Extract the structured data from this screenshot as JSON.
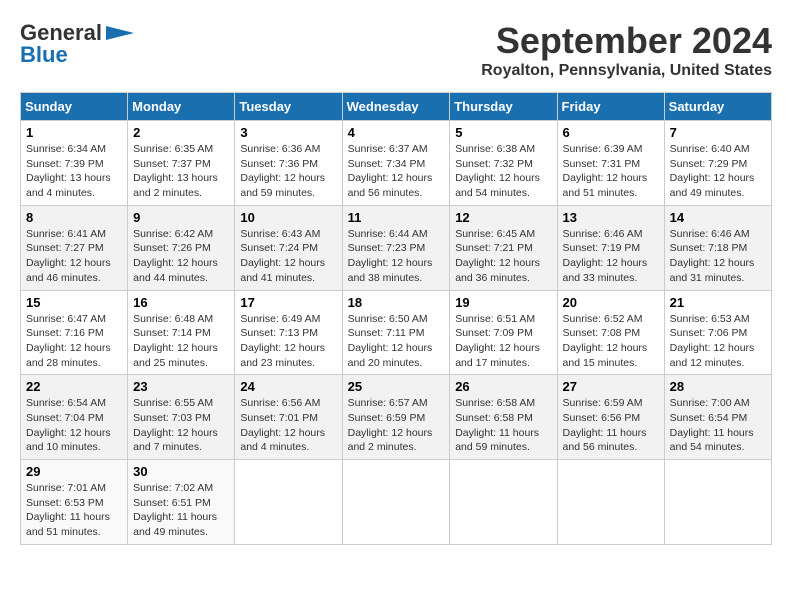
{
  "header": {
    "logo_general": "General",
    "logo_blue": "Blue",
    "month_title": "September 2024",
    "location": "Royalton, Pennsylvania, United States"
  },
  "days_of_week": [
    "Sunday",
    "Monday",
    "Tuesday",
    "Wednesday",
    "Thursday",
    "Friday",
    "Saturday"
  ],
  "weeks": [
    [
      {
        "day": "1",
        "sunrise": "6:34 AM",
        "sunset": "7:39 PM",
        "daylight": "13 hours and 4 minutes."
      },
      {
        "day": "2",
        "sunrise": "6:35 AM",
        "sunset": "7:37 PM",
        "daylight": "13 hours and 2 minutes."
      },
      {
        "day": "3",
        "sunrise": "6:36 AM",
        "sunset": "7:36 PM",
        "daylight": "12 hours and 59 minutes."
      },
      {
        "day": "4",
        "sunrise": "6:37 AM",
        "sunset": "7:34 PM",
        "daylight": "12 hours and 56 minutes."
      },
      {
        "day": "5",
        "sunrise": "6:38 AM",
        "sunset": "7:32 PM",
        "daylight": "12 hours and 54 minutes."
      },
      {
        "day": "6",
        "sunrise": "6:39 AM",
        "sunset": "7:31 PM",
        "daylight": "12 hours and 51 minutes."
      },
      {
        "day": "7",
        "sunrise": "6:40 AM",
        "sunset": "7:29 PM",
        "daylight": "12 hours and 49 minutes."
      }
    ],
    [
      {
        "day": "8",
        "sunrise": "6:41 AM",
        "sunset": "7:27 PM",
        "daylight": "12 hours and 46 minutes."
      },
      {
        "day": "9",
        "sunrise": "6:42 AM",
        "sunset": "7:26 PM",
        "daylight": "12 hours and 44 minutes."
      },
      {
        "day": "10",
        "sunrise": "6:43 AM",
        "sunset": "7:24 PM",
        "daylight": "12 hours and 41 minutes."
      },
      {
        "day": "11",
        "sunrise": "6:44 AM",
        "sunset": "7:23 PM",
        "daylight": "12 hours and 38 minutes."
      },
      {
        "day": "12",
        "sunrise": "6:45 AM",
        "sunset": "7:21 PM",
        "daylight": "12 hours and 36 minutes."
      },
      {
        "day": "13",
        "sunrise": "6:46 AM",
        "sunset": "7:19 PM",
        "daylight": "12 hours and 33 minutes."
      },
      {
        "day": "14",
        "sunrise": "6:46 AM",
        "sunset": "7:18 PM",
        "daylight": "12 hours and 31 minutes."
      }
    ],
    [
      {
        "day": "15",
        "sunrise": "6:47 AM",
        "sunset": "7:16 PM",
        "daylight": "12 hours and 28 minutes."
      },
      {
        "day": "16",
        "sunrise": "6:48 AM",
        "sunset": "7:14 PM",
        "daylight": "12 hours and 25 minutes."
      },
      {
        "day": "17",
        "sunrise": "6:49 AM",
        "sunset": "7:13 PM",
        "daylight": "12 hours and 23 minutes."
      },
      {
        "day": "18",
        "sunrise": "6:50 AM",
        "sunset": "7:11 PM",
        "daylight": "12 hours and 20 minutes."
      },
      {
        "day": "19",
        "sunrise": "6:51 AM",
        "sunset": "7:09 PM",
        "daylight": "12 hours and 17 minutes."
      },
      {
        "day": "20",
        "sunrise": "6:52 AM",
        "sunset": "7:08 PM",
        "daylight": "12 hours and 15 minutes."
      },
      {
        "day": "21",
        "sunrise": "6:53 AM",
        "sunset": "7:06 PM",
        "daylight": "12 hours and 12 minutes."
      }
    ],
    [
      {
        "day": "22",
        "sunrise": "6:54 AM",
        "sunset": "7:04 PM",
        "daylight": "12 hours and 10 minutes."
      },
      {
        "day": "23",
        "sunrise": "6:55 AM",
        "sunset": "7:03 PM",
        "daylight": "12 hours and 7 minutes."
      },
      {
        "day": "24",
        "sunrise": "6:56 AM",
        "sunset": "7:01 PM",
        "daylight": "12 hours and 4 minutes."
      },
      {
        "day": "25",
        "sunrise": "6:57 AM",
        "sunset": "6:59 PM",
        "daylight": "12 hours and 2 minutes."
      },
      {
        "day": "26",
        "sunrise": "6:58 AM",
        "sunset": "6:58 PM",
        "daylight": "11 hours and 59 minutes."
      },
      {
        "day": "27",
        "sunrise": "6:59 AM",
        "sunset": "6:56 PM",
        "daylight": "11 hours and 56 minutes."
      },
      {
        "day": "28",
        "sunrise": "7:00 AM",
        "sunset": "6:54 PM",
        "daylight": "11 hours and 54 minutes."
      }
    ],
    [
      {
        "day": "29",
        "sunrise": "7:01 AM",
        "sunset": "6:53 PM",
        "daylight": "11 hours and 51 minutes."
      },
      {
        "day": "30",
        "sunrise": "7:02 AM",
        "sunset": "6:51 PM",
        "daylight": "11 hours and 49 minutes."
      },
      null,
      null,
      null,
      null,
      null
    ]
  ]
}
